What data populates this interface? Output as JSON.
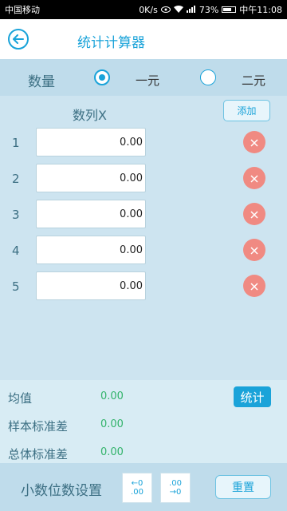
{
  "status_bar": {
    "carrier": "中国移动",
    "speed": "0K/s",
    "battery": "73%",
    "battery_level": 0.73,
    "time": "中午11:08"
  },
  "header": {
    "title": "统计计算器"
  },
  "quantity": {
    "label": "数量",
    "options": [
      {
        "label": "一元",
        "selected": true
      },
      {
        "label": "二元",
        "selected": false
      }
    ]
  },
  "list": {
    "column_header": "数列X",
    "add_label": "添加",
    "rows": [
      {
        "index": "1",
        "value": "0.00"
      },
      {
        "index": "2",
        "value": "0.00"
      },
      {
        "index": "3",
        "value": "0.00"
      },
      {
        "index": "4",
        "value": "0.00"
      },
      {
        "index": "5",
        "value": "0.00"
      }
    ]
  },
  "results": {
    "mean_label": "均值",
    "mean_value": "0.00",
    "sample_sd_label": "样本标准差",
    "sample_sd_value": "0.00",
    "population_sd_label": "总体标准差",
    "population_sd_value": "0.00",
    "stat_button": "统计"
  },
  "bottom": {
    "decimal_label": "小数位数设置",
    "decrease_top": "←0",
    "decrease_bottom": ".00",
    "increase_top": ".00",
    "increase_bottom": "→0",
    "reset_label": "重置"
  },
  "colors": {
    "accent": "#1aa3d9",
    "delete": "#f08a82",
    "result_value": "#33b36b"
  }
}
